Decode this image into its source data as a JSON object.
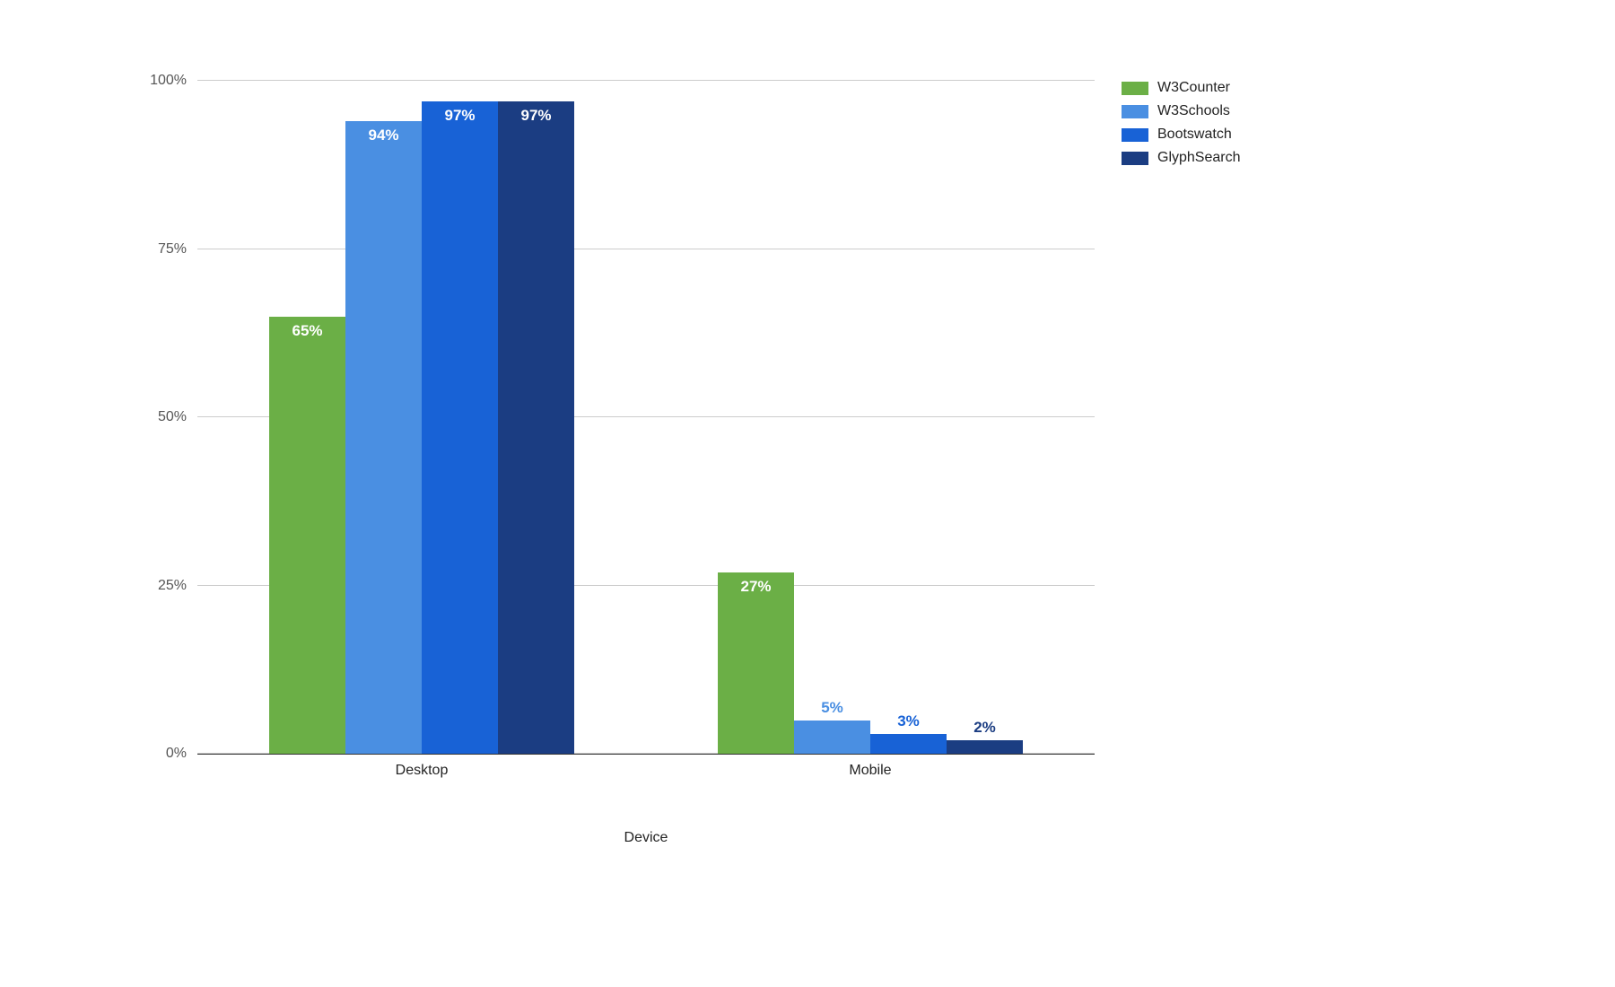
{
  "chart_data": {
    "type": "bar",
    "categories": [
      "Desktop",
      "Mobile"
    ],
    "series": [
      {
        "name": "W3Counter",
        "color": "#6BAF46",
        "values": [
          65,
          27
        ]
      },
      {
        "name": "W3Schools",
        "color": "#4A8FE2",
        "values": [
          94,
          5
        ]
      },
      {
        "name": "Bootswatch",
        "color": "#1862D6",
        "values": [
          97,
          3
        ]
      },
      {
        "name": "GlyphSearch",
        "color": "#1B3D82",
        "values": [
          97,
          2
        ]
      }
    ],
    "ylim": [
      0,
      100
    ],
    "y_ticks": [
      0,
      25,
      50,
      75,
      100
    ],
    "y_tick_labels": [
      "0%",
      "25%",
      "50%",
      "75%",
      "100%"
    ],
    "xlabel": "Device",
    "ylabel": "",
    "title": "",
    "value_suffix": "%",
    "label_outside_threshold": 6
  }
}
